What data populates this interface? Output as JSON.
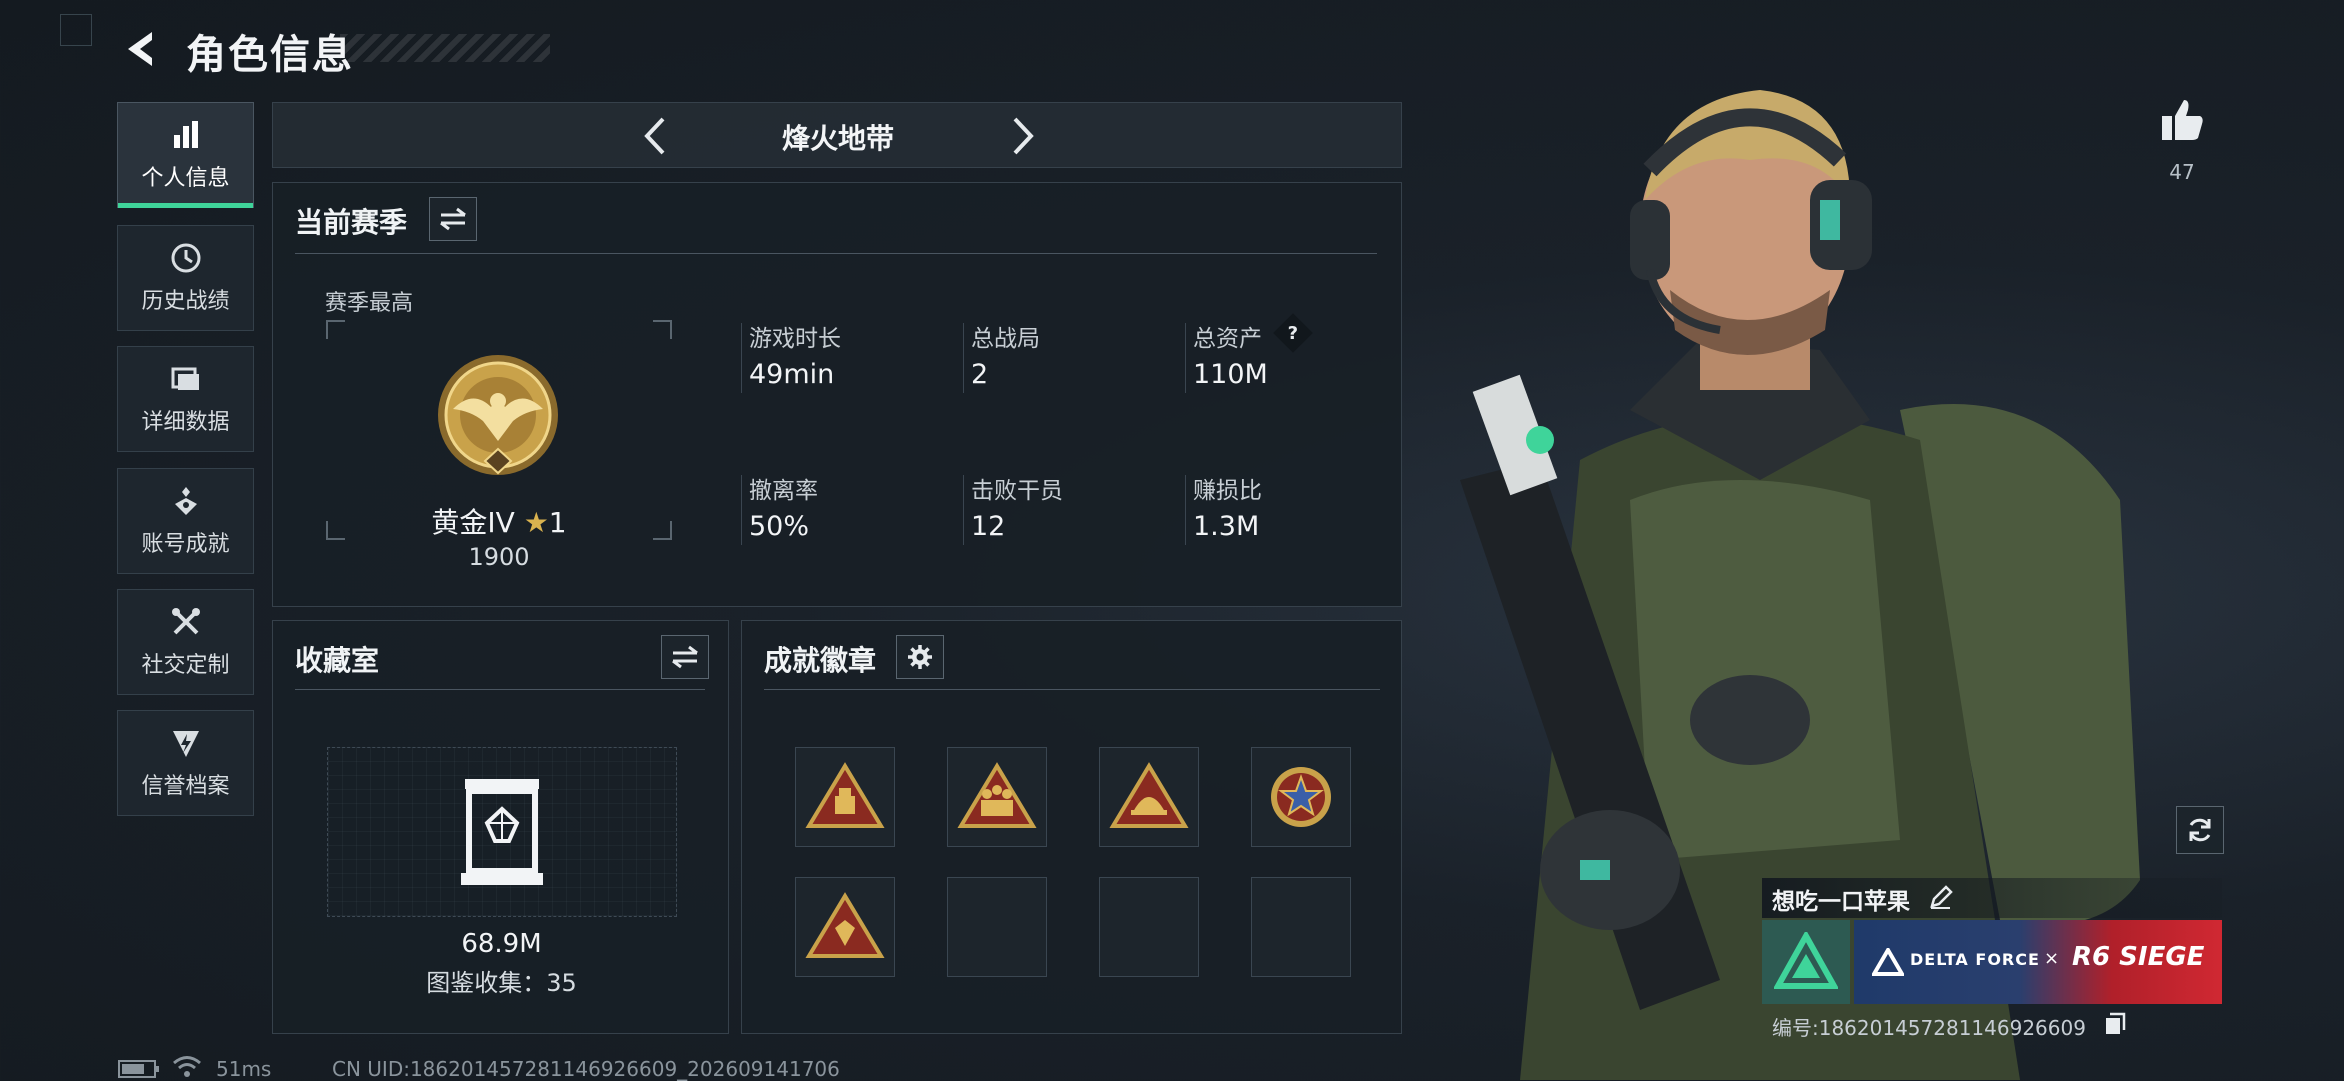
{
  "header": {
    "title": "角色信息"
  },
  "sidebar": {
    "items": [
      {
        "label": "个人信息",
        "icon": "bar-chart-icon",
        "active": true
      },
      {
        "label": "历史战绩",
        "icon": "history-clock-icon",
        "active": false
      },
      {
        "label": "详细数据",
        "icon": "folder-icon",
        "active": false
      },
      {
        "label": "账号成就",
        "icon": "medal-icon",
        "active": false
      },
      {
        "label": "社交定制",
        "icon": "tools-icon",
        "active": false
      },
      {
        "label": "信誉档案",
        "icon": "shield-bolt-icon",
        "active": false
      }
    ]
  },
  "mode": {
    "title": "烽火地带"
  },
  "season": {
    "title": "当前赛季",
    "best_label": "赛季最高",
    "rank_name": "黄金IV",
    "rank_stars": "1",
    "rank_score": "1900",
    "stats": [
      {
        "label": "游戏时长",
        "value": "49min"
      },
      {
        "label": "总战局",
        "value": "2"
      },
      {
        "label": "总资产",
        "value": "110M",
        "help": "?"
      },
      {
        "label": "撤离率",
        "value": "50%"
      },
      {
        "label": "击败干员",
        "value": "12"
      },
      {
        "label": "赚损比",
        "value": "1.3M"
      }
    ]
  },
  "collection": {
    "title": "收藏室",
    "value": "68.9M",
    "count_label": "图鉴收集：35"
  },
  "achievements": {
    "title": "成就徽章",
    "badges": [
      "crate-badge",
      "squad-badge",
      "helmet-badge",
      "star-emblem-badge",
      "gem-badge",
      "",
      "",
      ""
    ]
  },
  "likes": {
    "count": "47"
  },
  "player": {
    "name": "想吃一口苹果",
    "banner_brand1": "DELTA FORCE",
    "banner_x": "×",
    "banner_brand2": "R6 SIEGE",
    "id_label": "编号:186201457281146926609"
  },
  "footer": {
    "ping": "51ms",
    "uid": "CN UID:186201457281146926609_202609141706"
  },
  "colors": {
    "accent": "#3fd49a",
    "gold": "#c9a24a",
    "badge_red": "#8a2a20"
  }
}
